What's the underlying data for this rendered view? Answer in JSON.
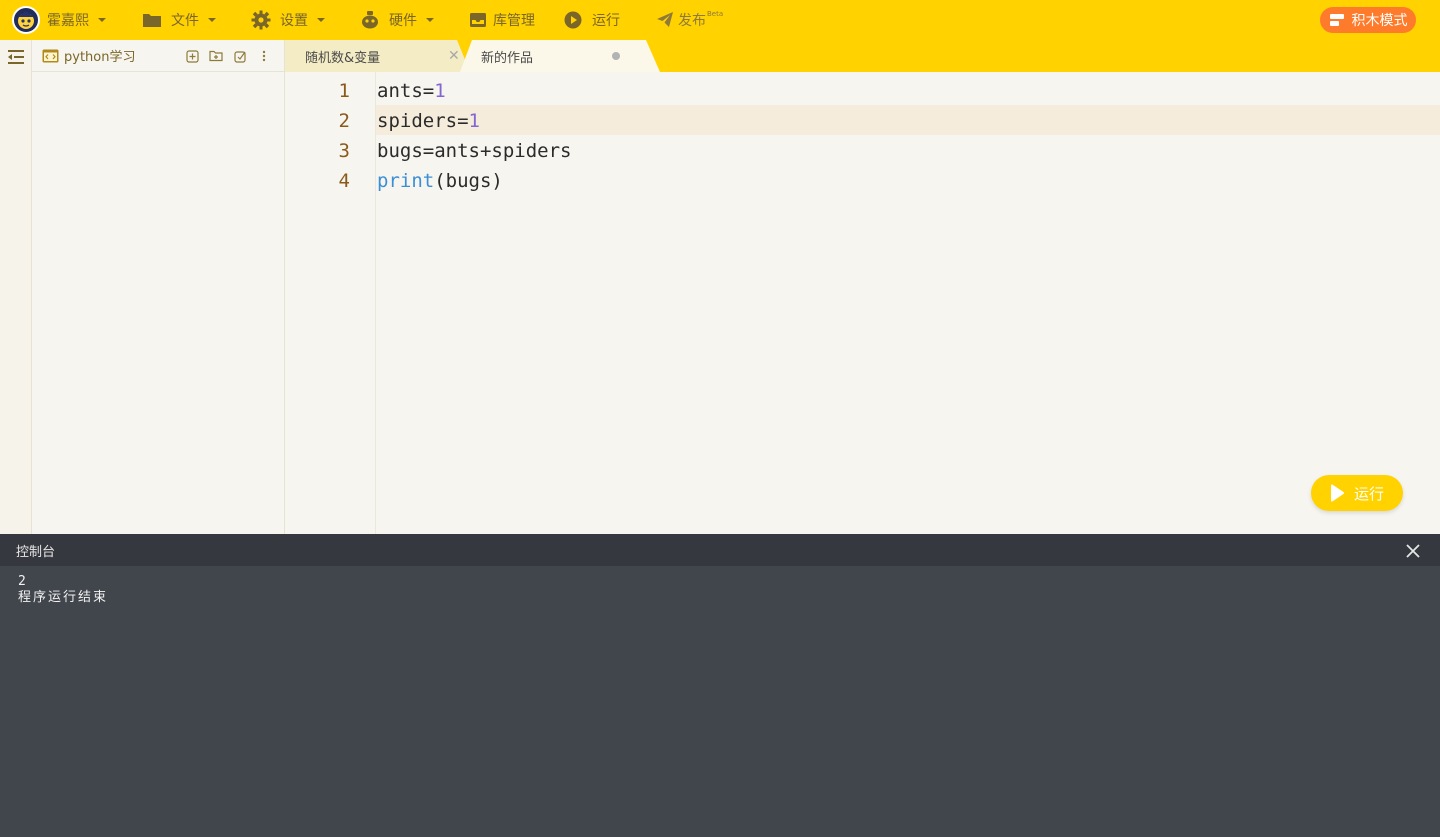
{
  "topbar": {
    "user_name": "霍嘉熙",
    "menus": {
      "file": "文件",
      "settings": "设置",
      "hardware": "硬件",
      "library": "库管理",
      "run": "运行",
      "publish": "发布",
      "publish_badge": "Beta"
    },
    "blocks_mode": "积木模式"
  },
  "sidebar": {
    "project_name": "python学习"
  },
  "tabs": [
    {
      "label": "随机数&变量",
      "state": "closable"
    },
    {
      "label": "新的作品",
      "state": "active-unsaved"
    }
  ],
  "editor": {
    "line_numbers": [
      "1",
      "2",
      "3",
      "4"
    ],
    "lines": [
      {
        "text": "ants=",
        "num": "1"
      },
      {
        "text": "spiders=",
        "num": "1"
      },
      {
        "text": "bugs=ants+spiders"
      },
      {
        "kw": "print",
        "rest": "(bugs)"
      }
    ],
    "highlighted_line": 2,
    "run_button": "运行"
  },
  "console": {
    "title": "控制台",
    "output": [
      "2",
      "程序运行结束"
    ]
  },
  "colors": {
    "toolbar": "#ffd200",
    "accent_orange": "#ff7b2c",
    "console_bg": "#41454c"
  }
}
